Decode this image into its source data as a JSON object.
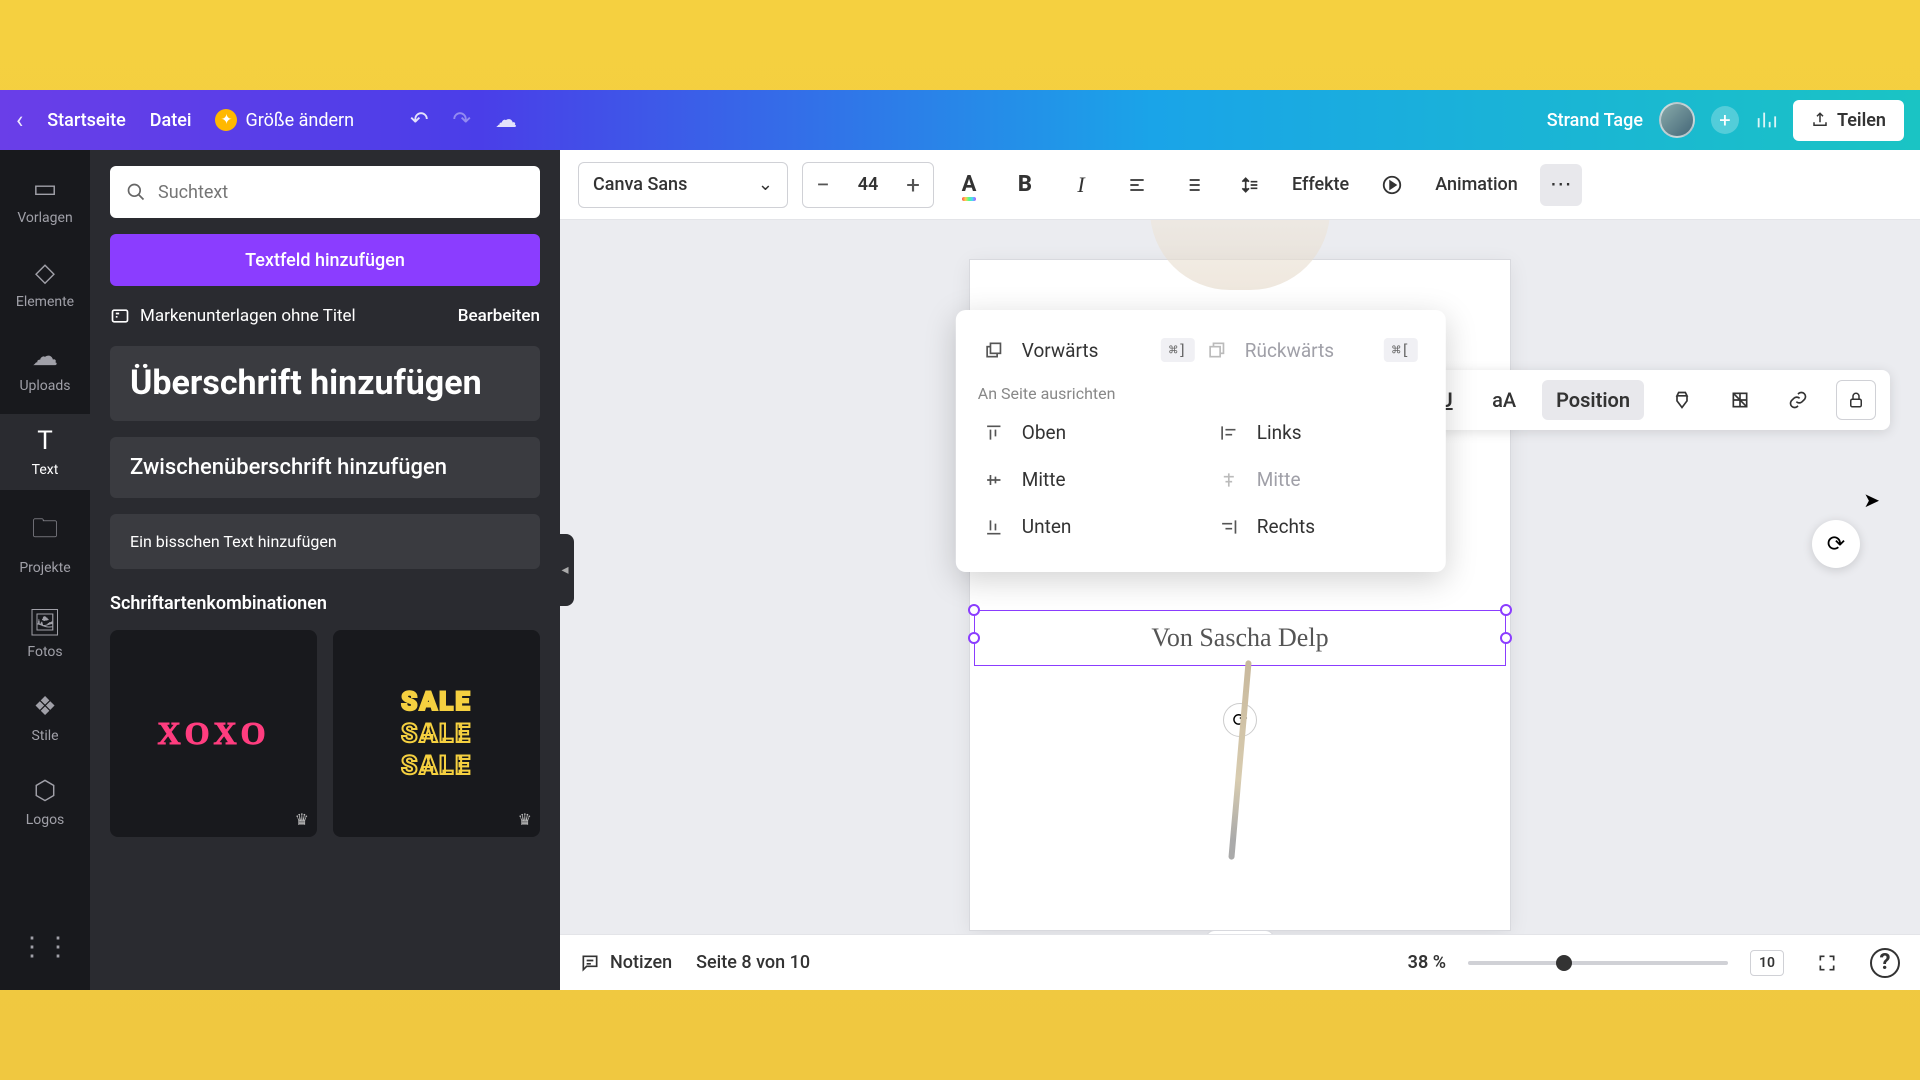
{
  "header": {
    "home": "Startseite",
    "file": "Datei",
    "resize": "Größe ändern",
    "doc_title": "Strand Tage",
    "share": "Teilen"
  },
  "rail": {
    "templates": "Vorlagen",
    "elements": "Elemente",
    "uploads": "Uploads",
    "text": "Text",
    "projects": "Projekte",
    "photos": "Fotos",
    "styles": "Stile",
    "logos": "Logos"
  },
  "panel": {
    "search_placeholder": "Suchtext",
    "add_textbox": "Textfeld hinzufügen",
    "brand_docs": "Markenunterlagen ohne Titel",
    "edit": "Bearbeiten",
    "preset_heading": "Überschrift hinzufügen",
    "preset_subheading": "Zwischenüberschrift hinzufügen",
    "preset_body": "Ein bisschen Text hinzufügen",
    "font_combos": "Schriftartenkombinationen",
    "combo1": "XOXO",
    "combo2": "SALE"
  },
  "toolbar": {
    "font": "Canva Sans",
    "size": "44",
    "effects": "Effekte",
    "animation": "Animation",
    "position": "Position"
  },
  "popover": {
    "forward": "Vorwärts",
    "forward_key": "⌘]",
    "backward": "Rückwärts",
    "backward_key": "⌘[",
    "align_section": "An Seite ausrichten",
    "top": "Oben",
    "left": "Links",
    "middle_v": "Mitte",
    "middle_h": "Mitte",
    "bottom": "Unten",
    "right": "Rechts"
  },
  "canvas": {
    "selected_text": "Von Sascha Delp"
  },
  "footer": {
    "notes": "Notizen",
    "page_indicator": "Seite 8 von 10",
    "zoom": "38 %",
    "grid_count": "10"
  }
}
